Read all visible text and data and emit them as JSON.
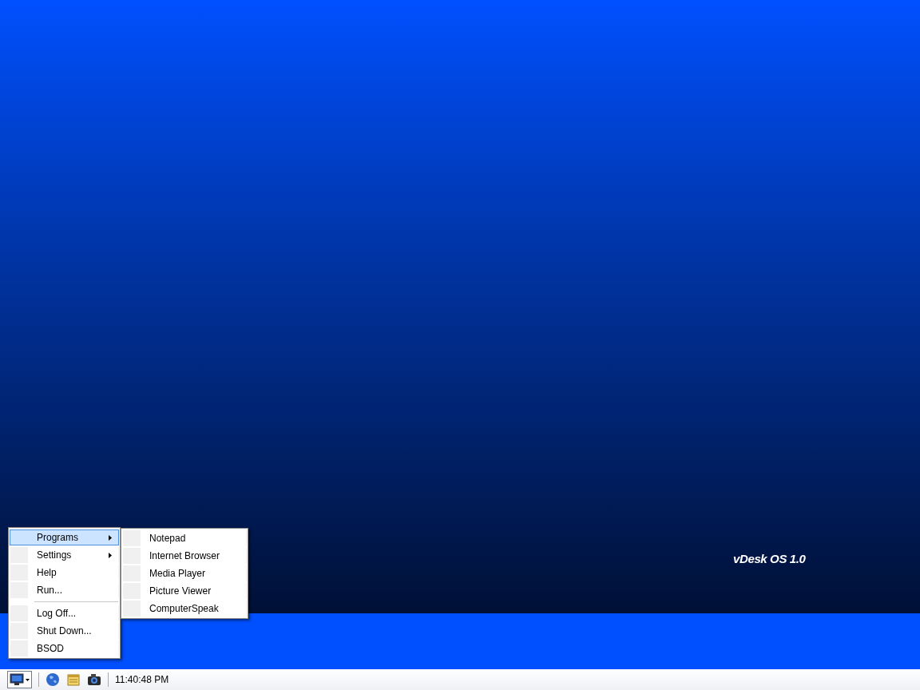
{
  "desktop": {
    "caption": "vDesk OS 1.0"
  },
  "start_menu": {
    "items": [
      {
        "kind": "item",
        "label": "Programs",
        "has_submenu": true,
        "selected": true
      },
      {
        "kind": "item",
        "label": "Settings",
        "has_submenu": true,
        "selected": false
      },
      {
        "kind": "item",
        "label": "Help",
        "has_submenu": false,
        "selected": false
      },
      {
        "kind": "item",
        "label": "Run...",
        "has_submenu": false,
        "selected": false
      },
      {
        "kind": "separator"
      },
      {
        "kind": "item",
        "label": "Log Off...",
        "has_submenu": false,
        "selected": false
      },
      {
        "kind": "item",
        "label": "Shut Down...",
        "has_submenu": false,
        "selected": false
      },
      {
        "kind": "item",
        "label": "BSOD",
        "has_submenu": false,
        "selected": false
      }
    ]
  },
  "programs_submenu": {
    "items": [
      {
        "label": "Notepad",
        "selected": false
      },
      {
        "label": "Internet Browser",
        "selected": false
      },
      {
        "label": "Media Player",
        "selected": false
      },
      {
        "label": "Picture Viewer",
        "selected": false
      },
      {
        "label": "ComputerSpeak",
        "selected": false
      }
    ]
  },
  "taskbar": {
    "clock": "11:40:48 PM"
  }
}
